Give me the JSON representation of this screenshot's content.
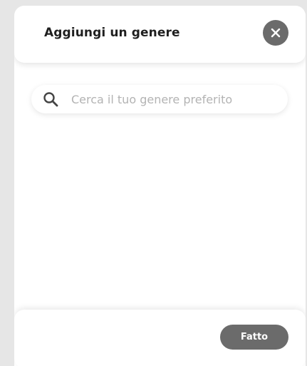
{
  "dialog": {
    "title": "Aggiungi un genere",
    "close_icon": "close-icon",
    "close_button_color": "#6b6b6b"
  },
  "search": {
    "icon": "search-icon",
    "placeholder": "Cerca il tuo genere preferito",
    "value": ""
  },
  "footer": {
    "done_label": "Fatto",
    "done_button_color": "#6b6b6b"
  }
}
